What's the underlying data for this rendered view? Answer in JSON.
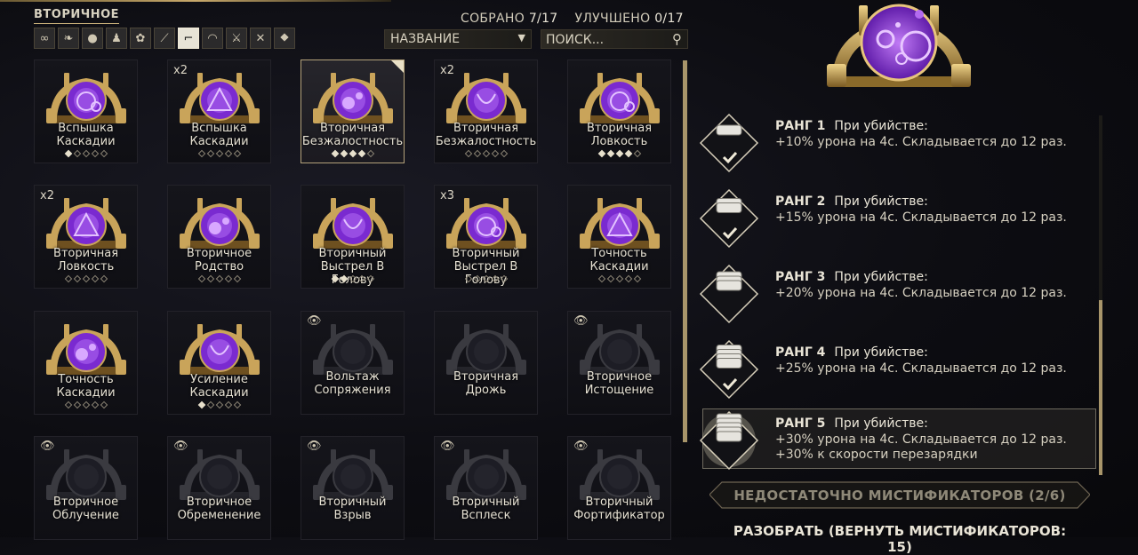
{
  "header": {
    "tab_title": "ВТОРИЧНОЕ",
    "collected_label": "СОБРАНО",
    "collected_value": "7/17",
    "upgraded_label": "УЛУЧШЕНО",
    "upgraded_value": "0/17",
    "sort_value": "НАЗВАНИЕ",
    "search_placeholder": "ПОИСК..."
  },
  "filters": [
    {
      "icon": "infinity-icon",
      "glyph": "∞",
      "active": false
    },
    {
      "icon": "wing-icon",
      "glyph": "❧",
      "active": false
    },
    {
      "icon": "warframe-bust-icon",
      "glyph": "●",
      "active": false
    },
    {
      "icon": "companion-icon",
      "glyph": "♟",
      "active": false
    },
    {
      "icon": "archwing-icon",
      "glyph": "✿",
      "active": false
    },
    {
      "icon": "primary-weapon-icon",
      "glyph": "⟋",
      "active": false
    },
    {
      "icon": "secondary-pistol-icon",
      "glyph": "⌐",
      "active": true
    },
    {
      "icon": "melee-whip-icon",
      "glyph": "◠",
      "active": false
    },
    {
      "icon": "melee-sword-icon",
      "glyph": "⚔",
      "active": false
    },
    {
      "icon": "crossed-blades-icon",
      "glyph": "✕",
      "active": false
    },
    {
      "icon": "archgun-icon",
      "glyph": "⯁",
      "active": false
    }
  ],
  "cards": [
    {
      "name": "Вспышка Каскадии",
      "count": "",
      "ranks": 5,
      "filled": 1,
      "locked": false,
      "selected": false,
      "eye": false,
      "col": 0,
      "row": 0
    },
    {
      "name": "Вспышка Каскадии",
      "count": "x2",
      "ranks": 5,
      "filled": 0,
      "locked": false,
      "selected": false,
      "eye": false,
      "col": 1,
      "row": 0
    },
    {
      "name": "Вторичная Безжалостность",
      "count": "",
      "ranks": 5,
      "filled": 4,
      "locked": false,
      "selected": true,
      "eye": false,
      "col": 2,
      "row": 0
    },
    {
      "name": "Вторичная Безжалостность",
      "count": "x2",
      "ranks": 5,
      "filled": 0,
      "locked": false,
      "selected": false,
      "eye": false,
      "col": 3,
      "row": 0
    },
    {
      "name": "Вторичная Ловкость",
      "count": "",
      "ranks": 5,
      "filled": 4,
      "locked": false,
      "selected": false,
      "eye": false,
      "col": 4,
      "row": 0
    },
    {
      "name": "Вторичная Ловкость",
      "count": "x2",
      "ranks": 5,
      "filled": 0,
      "locked": false,
      "selected": false,
      "eye": false,
      "col": 0,
      "row": 1
    },
    {
      "name": "Вторичное Родство",
      "count": "",
      "ranks": 5,
      "filled": 0,
      "locked": false,
      "selected": false,
      "eye": false,
      "col": 1,
      "row": 1
    },
    {
      "name": "Вторичный Выстрел В Голову",
      "count": "",
      "ranks": 5,
      "filled": 2,
      "locked": false,
      "selected": false,
      "eye": false,
      "col": 2,
      "row": 1
    },
    {
      "name": "Вторичный Выстрел В Голову",
      "count": "x3",
      "ranks": 5,
      "filled": 0,
      "locked": false,
      "selected": false,
      "eye": false,
      "col": 3,
      "row": 1
    },
    {
      "name": "Точность Каскадии",
      "count": "",
      "ranks": 5,
      "filled": 0,
      "locked": false,
      "selected": false,
      "eye": false,
      "col": 4,
      "row": 1
    },
    {
      "name": "Точность Каскадии",
      "count": "",
      "ranks": 5,
      "filled": 0,
      "locked": false,
      "selected": false,
      "eye": false,
      "col": 0,
      "row": 2
    },
    {
      "name": "Усиление Каскадии",
      "count": "",
      "ranks": 5,
      "filled": 1,
      "locked": false,
      "selected": false,
      "eye": false,
      "col": 1,
      "row": 2
    },
    {
      "name": "Вольтаж Сопряжения",
      "count": "",
      "ranks": 0,
      "filled": 0,
      "locked": true,
      "selected": false,
      "eye": true,
      "col": 2,
      "row": 2
    },
    {
      "name": "Вторичная Дрожь",
      "count": "",
      "ranks": 0,
      "filled": 0,
      "locked": true,
      "selected": false,
      "eye": false,
      "col": 3,
      "row": 2
    },
    {
      "name": "Вторичное Истощение",
      "count": "",
      "ranks": 0,
      "filled": 0,
      "locked": true,
      "selected": false,
      "eye": true,
      "col": 4,
      "row": 2
    },
    {
      "name": "Вторичное Облучение",
      "count": "",
      "ranks": 0,
      "filled": 0,
      "locked": true,
      "selected": false,
      "eye": true,
      "col": 0,
      "row": 3
    },
    {
      "name": "Вторичное Обременение",
      "count": "",
      "ranks": 0,
      "filled": 0,
      "locked": true,
      "selected": false,
      "eye": true,
      "col": 1,
      "row": 3
    },
    {
      "name": "Вторичный Взрыв",
      "count": "",
      "ranks": 0,
      "filled": 0,
      "locked": true,
      "selected": false,
      "eye": true,
      "col": 2,
      "row": 3
    },
    {
      "name": "Вторичный Всплеск",
      "count": "",
      "ranks": 0,
      "filled": 0,
      "locked": true,
      "selected": false,
      "eye": true,
      "col": 3,
      "row": 3
    },
    {
      "name": "Вторичный Фортификатор",
      "count": "",
      "ranks": 0,
      "filled": 0,
      "locked": true,
      "selected": false,
      "eye": true,
      "col": 4,
      "row": 3
    }
  ],
  "ranks": [
    {
      "title": "РАНГ 1",
      "trigger": "При убийстве:",
      "lines": [
        "+10% урона на 4с. Складывается до 12 раз."
      ],
      "checked": true,
      "active": false,
      "stack": 1
    },
    {
      "title": "РАНГ 2",
      "trigger": "При убийстве:",
      "lines": [
        "+15% урона на 4с. Складывается до 12 раз."
      ],
      "checked": true,
      "active": false,
      "stack": 2
    },
    {
      "title": "РАНГ 3",
      "trigger": "При убийстве:",
      "lines": [
        "+20% урона на 4с. Складывается до 12 раз."
      ],
      "checked": false,
      "active": false,
      "stack": 3
    },
    {
      "title": "РАНГ 4",
      "trigger": "При убийстве:",
      "lines": [
        "+25% урона на 4с. Складывается до 12 раз."
      ],
      "checked": true,
      "active": false,
      "stack": 4
    },
    {
      "title": "РАНГ 5",
      "trigger": "При убийстве:",
      "lines": [
        "+30% урона на 4с. Складывается до 12 раз.",
        "+30% к скорости перезарядки"
      ],
      "checked": false,
      "active": true,
      "stack": 5
    }
  ],
  "footer": {
    "insufficient_label": "НЕДОСТАТОЧНО МИСТИФИКАТОРОВ (2/6)",
    "dismantle_label": "РАЗОБРАТЬ (ВЕРНУТЬ МИСТИФИКАТОРОВ: 15)"
  },
  "colors": {
    "accent_gold": "#c7a86a",
    "purple": "#8a3ad6"
  }
}
